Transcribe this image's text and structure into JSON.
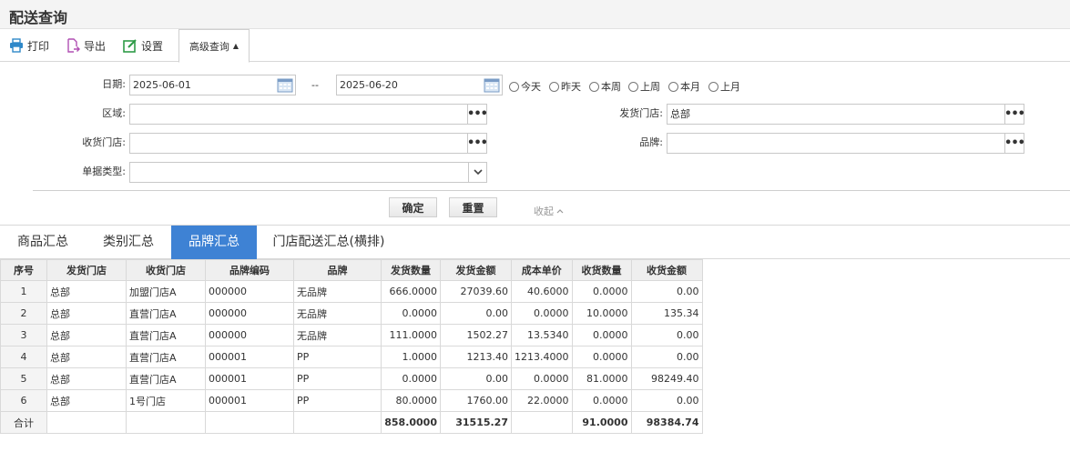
{
  "title": "配送查询",
  "toolbar": {
    "print": "打印",
    "export": "导出",
    "settings": "设置",
    "advanced": "高级查询"
  },
  "form": {
    "date_label": "日期:",
    "date_from": "2025-06-01",
    "date_sep": "--",
    "date_to": "2025-06-20",
    "quick": [
      "今天",
      "昨天",
      "本周",
      "上周",
      "本月",
      "上月"
    ],
    "region_label": "区域:",
    "region_value": "",
    "ship_store_label": "发货门店:",
    "ship_store_value": "总部",
    "recv_store_label": "收货门店:",
    "recv_store_value": "",
    "brand_label": "品牌:",
    "brand_value": "",
    "doc_type_label": "单据类型:",
    "doc_type_value": "",
    "confirm": "确定",
    "reset": "重置",
    "collapse": "收起"
  },
  "tabs": [
    "商品汇总",
    "类别汇总",
    "品牌汇总",
    "门店配送汇总(横排)"
  ],
  "active_tab": 2,
  "table": {
    "headers": [
      "序号",
      "发货门店",
      "收货门店",
      "品牌编码",
      "品牌",
      "发货数量",
      "发货金额",
      "成本单价",
      "收货数量",
      "收货金额"
    ],
    "rows": [
      [
        "1",
        "总部",
        "加盟门店A",
        "000000",
        "无品牌",
        "666.0000",
        "27039.60",
        "40.6000",
        "0.0000",
        "0.00"
      ],
      [
        "2",
        "总部",
        "直营门店A",
        "000000",
        "无品牌",
        "0.0000",
        "0.00",
        "0.0000",
        "10.0000",
        "135.34"
      ],
      [
        "3",
        "总部",
        "直营门店A",
        "000000",
        "无品牌",
        "111.0000",
        "1502.27",
        "13.5340",
        "0.0000",
        "0.00"
      ],
      [
        "4",
        "总部",
        "直营门店A",
        "000001",
        "PP",
        "1.0000",
        "1213.40",
        "1213.4000",
        "0.0000",
        "0.00"
      ],
      [
        "5",
        "总部",
        "直营门店A",
        "000001",
        "PP",
        "0.0000",
        "0.00",
        "0.0000",
        "81.0000",
        "98249.40"
      ],
      [
        "6",
        "总部",
        "1号门店",
        "000001",
        "PP",
        "80.0000",
        "1760.00",
        "22.0000",
        "0.0000",
        "0.00"
      ]
    ],
    "total": [
      "合计",
      "",
      "",
      "",
      "",
      "858.0000",
      "31515.27",
      "",
      "91.0000",
      "98384.74"
    ]
  },
  "colors": {
    "accent": "#3e82d4",
    "print_icon": "#2f88c9",
    "export_icon": "#b04fb3",
    "settings_icon": "#2e9b47"
  }
}
